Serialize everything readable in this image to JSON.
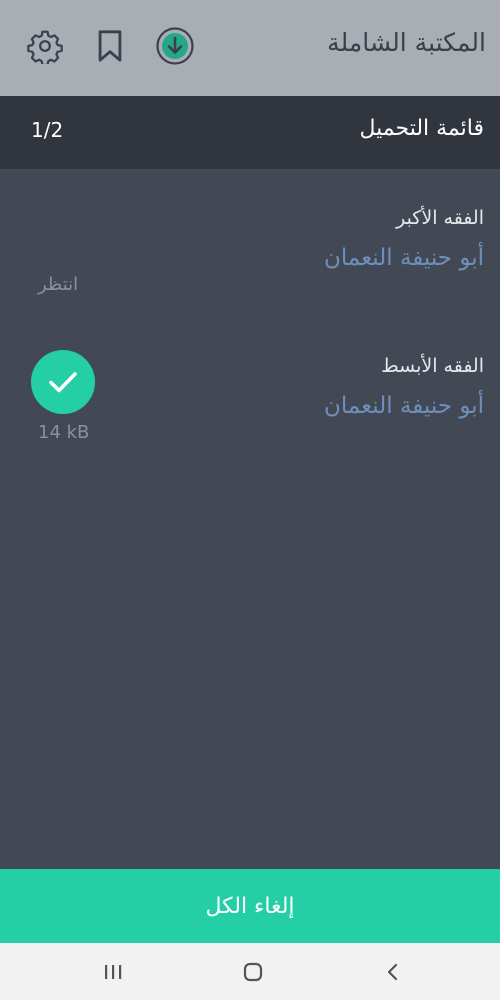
{
  "appbar": {
    "title": "المكتبة الشاملة",
    "icons": [
      "gear-icon",
      "bookmark-icon",
      "download-icon"
    ],
    "background": "#a9aeb5"
  },
  "section": {
    "title": "قائمة التحميل",
    "counter": "1/2"
  },
  "downloads": [
    {
      "title": "الفقه الأكبر",
      "author": "أبو حنيفة النعمان",
      "status": "انتظر"
    },
    {
      "title": "الفقه الأبسط",
      "author": "أبو حنيفة النعمان",
      "status": "complete",
      "size": "14 kB",
      "status_icon": "checkmark-icon"
    }
  ],
  "cancel_all_label": "إلغاء الكل",
  "navbar": {
    "icons": [
      "recent-apps-icon",
      "home-icon",
      "back-icon"
    ]
  },
  "colors": {
    "accent": "#24cfa6",
    "author_link": "#6d8fbb",
    "background": "#424955",
    "header": "#30353e"
  }
}
